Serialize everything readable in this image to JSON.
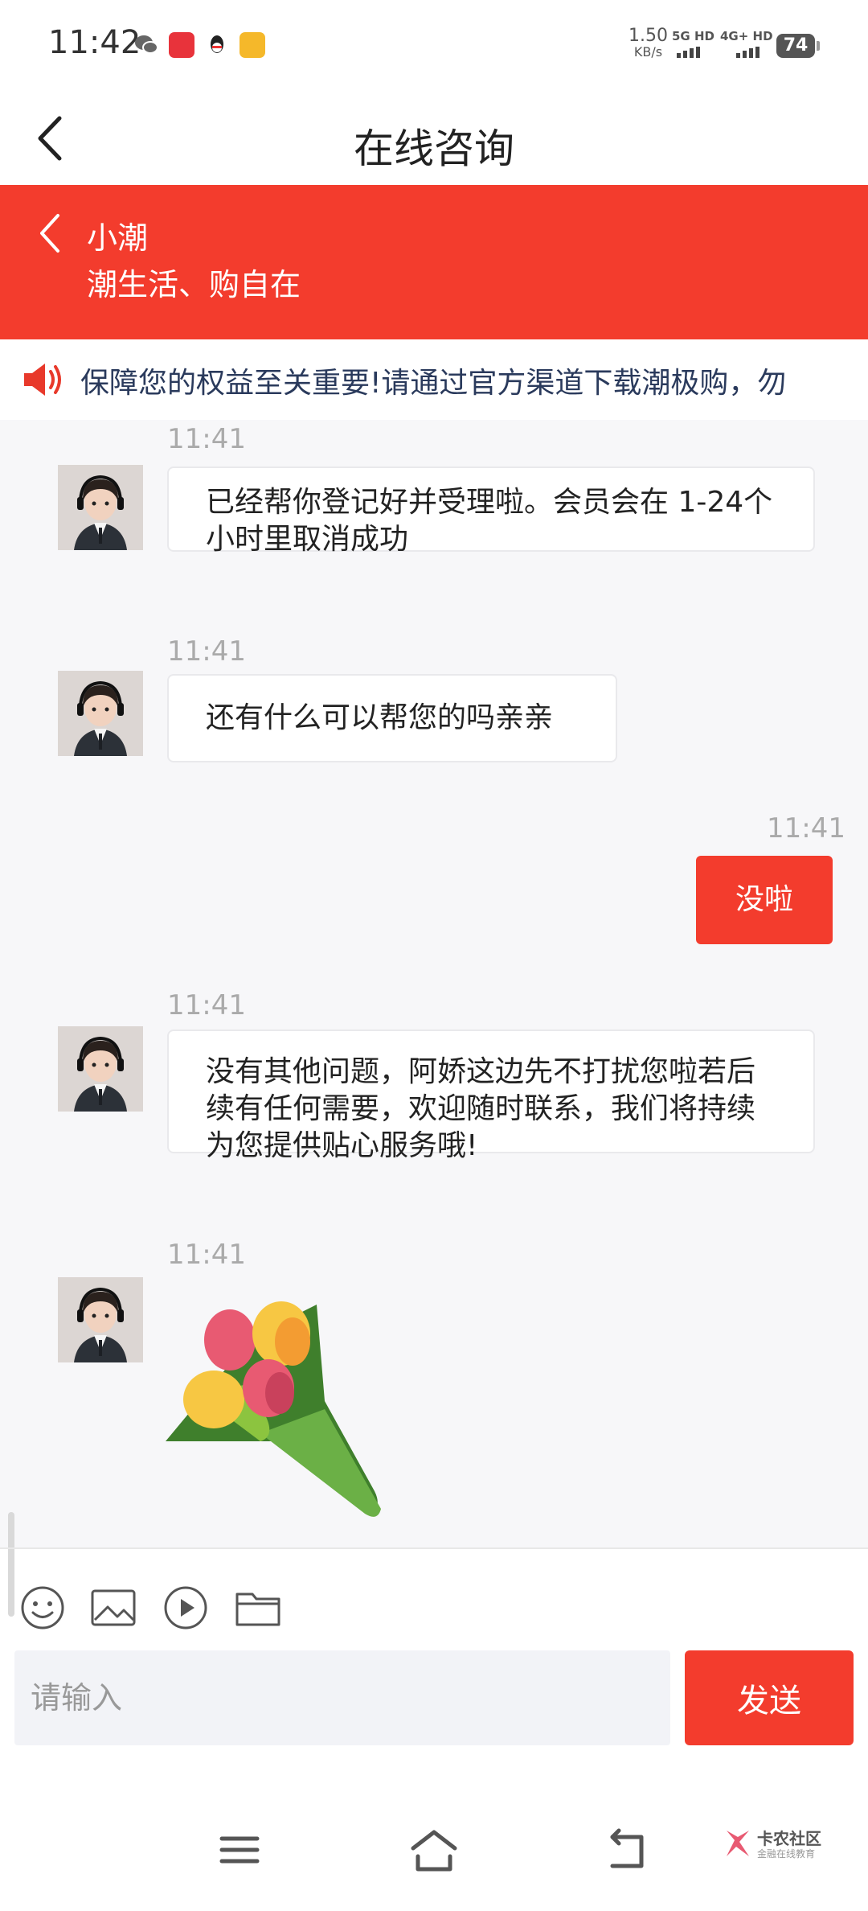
{
  "status_bar": {
    "time": "11:42",
    "apps": [
      "wechat-icon",
      "red-app-icon",
      "qq-icon",
      "yellow-app-icon"
    ],
    "net_speed": "1.50",
    "net_speed_unit": "KB/s",
    "sim1": "5G HD",
    "sim2": "4G+ HD",
    "battery": "74"
  },
  "header": {
    "title": "在线咨询"
  },
  "chat_header": {
    "agent_name": "小潮",
    "slogan": "潮生活、购自在",
    "color": "#f33c2d"
  },
  "notice": {
    "text": "保障您的权益至关重要!请通过官方渠道下载潮极购，勿"
  },
  "messages": [
    {
      "from": "agent",
      "time": "11:41",
      "text": "已经帮你登记好并受理啦。会员会在 1-24个小时里取消成功"
    },
    {
      "from": "agent",
      "time": "11:41",
      "text": "还有什么可以帮您的吗亲亲"
    },
    {
      "from": "user",
      "time": "11:41",
      "text": "没啦"
    },
    {
      "from": "agent",
      "time": "11:41",
      "text": "没有其他问题，阿娇这边先不打扰您啦若后续有任何需要，欢迎随时联系，我们将持续为您提供贴心服务哦!"
    },
    {
      "from": "agent",
      "time": "11:41",
      "sticker": "tulip-bouquet"
    }
  ],
  "input": {
    "placeholder": "请输入",
    "value": "",
    "send_label": "发送",
    "tools": [
      "emoji-icon",
      "image-icon",
      "video-icon",
      "folder-icon"
    ]
  },
  "watermark": {
    "title": "卡农社区",
    "subtitle": "金融在线教育"
  }
}
